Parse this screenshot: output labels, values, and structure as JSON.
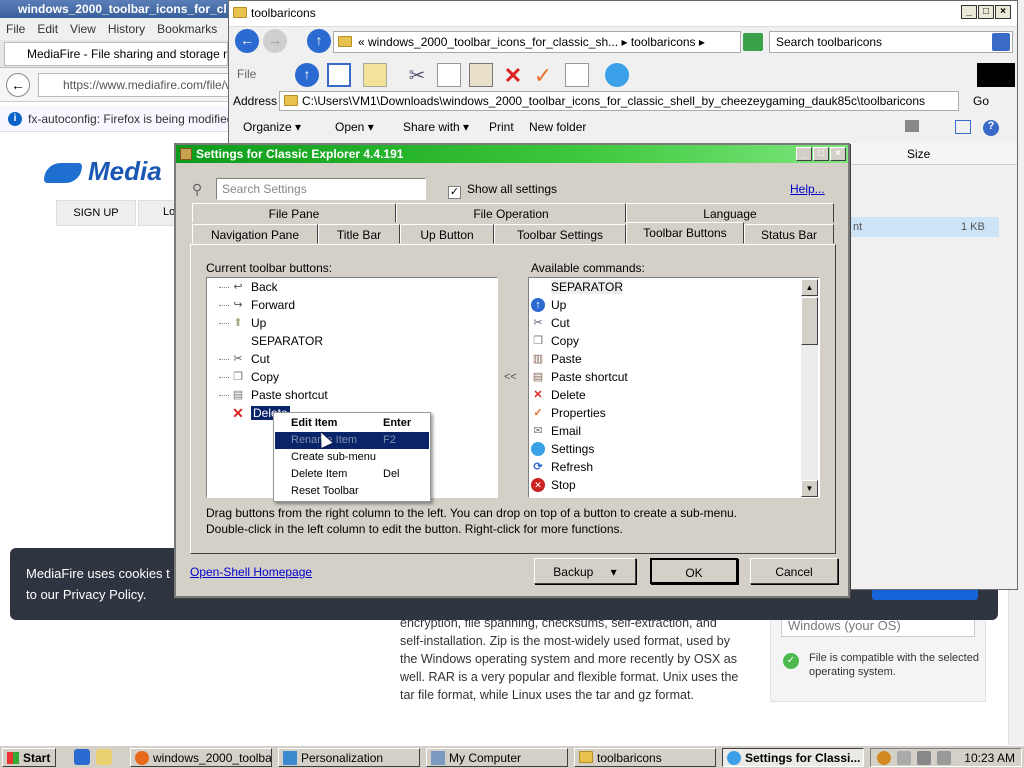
{
  "firefox": {
    "title": "windows_2000_toolbar_icons_for_cl",
    "menu": [
      "File",
      "Edit",
      "View",
      "History",
      "Bookmarks"
    ],
    "tab_label": "MediaFire - File sharing and storage mad...",
    "url": "https://www.mediafire.com/file/vl",
    "info_bar": "fx-autoconfig: Firefox is being modified w",
    "logo_text": "Media",
    "signup": "SIGN UP",
    "login": "Lo",
    "cookie_line1": "MediaFire uses cookies t",
    "cookie_line2": "to our Privacy Policy.",
    "article": "diskspace. Archiving software may also provide options for encryption, file spanning, checksums, self-extraction, and self-installation. Zip is the most-widely used format, used by the Windows operating system and more recently by OSX as well. RAR is a very popular and flexible format. Unix uses the tar file format, while Linux uses the tar and gz format.",
    "os_select": "Windows (your OS)",
    "compat_text": "File is compatible with the selected operating system."
  },
  "explorer": {
    "title": "toolbaricons",
    "breadcrumb": "« windows_2000_toolbar_icons_for_classic_sh... ▸ toolbaricons ▸",
    "search_placeholder": "Search toolbaricons",
    "file_label": "File",
    "address_label": "Address",
    "address": "C:\\Users\\VM1\\Downloads\\windows_2000_toolbar_icons_for_classic_shell_by_cheezeygaming_dauk85c\\toolbaricons",
    "go": "Go",
    "cmd": [
      "Organize ▾",
      "Open ▾",
      "Share with ▾",
      "Print",
      "New folder"
    ],
    "col_size": "Size",
    "file_partial": "nt",
    "file_size": "1 KB"
  },
  "dialog": {
    "title": "Settings for Classic Explorer 4.4.191",
    "search_placeholder": "Search Settings",
    "show_all": "Show all settings",
    "help": "Help...",
    "tabs_row1": [
      "File Pane",
      "File Operation",
      "Language"
    ],
    "tabs_row2": [
      "Navigation Pane",
      "Title Bar",
      "Up Button",
      "Toolbar Settings",
      "Toolbar Buttons",
      "Status Bar"
    ],
    "current_label": "Current toolbar buttons:",
    "available_label": "Available commands:",
    "current_items": [
      "Back",
      "Forward",
      "Up",
      "SEPARATOR",
      "Cut",
      "Copy",
      "Paste shortcut",
      "Delete"
    ],
    "available_items": [
      "SEPARATOR",
      "Up",
      "Cut",
      "Copy",
      "Paste",
      "Paste shortcut",
      "Delete",
      "Properties",
      "Email",
      "Settings",
      "Refresh",
      "Stop"
    ],
    "arrows": "<<",
    "hint1": "Drag buttons from the right column to the left. You can drop on top of a button to create a sub-menu.",
    "hint2": "Double-click in the left column to edit the button. Right-click for more functions.",
    "homepage": "Open-Shell Homepage",
    "backup": "Backup",
    "ok": "OK",
    "cancel": "Cancel"
  },
  "context_menu": [
    {
      "label": "Edit Item",
      "key": "Enter"
    },
    {
      "label": "Rename Item",
      "key": "F2"
    },
    {
      "label": "Create sub-menu",
      "key": ""
    },
    {
      "label": "Delete Item",
      "key": "Del"
    },
    {
      "label": "Reset Toolbar",
      "key": ""
    }
  ],
  "taskbar": {
    "start": "Start",
    "tasks": [
      "windows_2000_toolba...",
      "Personalization",
      "My Computer",
      "toolbaricons",
      "Settings for Classi..."
    ],
    "clock": "10:23 AM"
  },
  "colors": {
    "dialog_title": "#0c9b1a",
    "selection": "#0a246a",
    "link": "#0000cc"
  }
}
